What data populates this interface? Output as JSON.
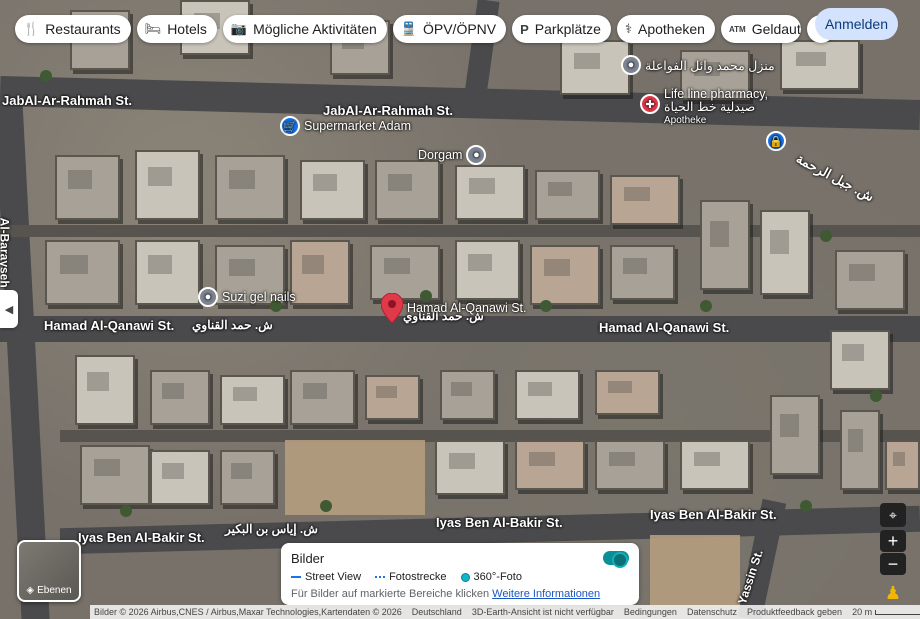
{
  "chips": [
    {
      "icon": "restaurant-icon",
      "glyph": "🍴",
      "label": "Restaurants"
    },
    {
      "icon": "hotel-icon",
      "glyph": "🛏",
      "label": "Hotels"
    },
    {
      "icon": "camera-icon",
      "glyph": "📷",
      "label": "Mögliche Aktivitäten"
    },
    {
      "icon": "transit-icon",
      "glyph": "🚆",
      "label": "ÖPV/ÖPNV"
    },
    {
      "icon": "parking-icon",
      "glyph": "P",
      "label": "Parkplätze"
    },
    {
      "icon": "pharmacy-icon",
      "glyph": "⚕",
      "label": "Apotheken"
    },
    {
      "icon": "atm-icon",
      "glyph": "ATM",
      "label": "Geldauto"
    }
  ],
  "header": {
    "signin_label": "Anmelden"
  },
  "streets": {
    "jabal_top": "JabAl-Ar-Rahmah St.",
    "jabal_mid": "JabAl-Ar-Rahmah St.",
    "jabal_arabic": "ش. جبل الرحمة",
    "hamad_left": "Hamad Al-Qanawi St.",
    "hamad_arabic_left": "ش. حمد القناوي",
    "hamad_center": "Hamad Al-Qanawi St.",
    "hamad_arabic_center": "ش. حمد القناوي",
    "hamad_right": "Hamad Al-Qanawi St.",
    "iyas_left": "Iyas Ben Al-Bakir St.",
    "iyas_arabic": "ش. إياس بن البكير",
    "iyas_center": "Iyas Ben Al-Bakir St.",
    "iyas_right": "Iyas Ben Al-Bakir St.",
    "barayseh": "Al-Barayseh St.",
    "yassin": "Yassin St."
  },
  "places": {
    "supermarket": "Supermarket Adam",
    "dorgam": "Dorgam",
    "suzi": "Suzi gel nails",
    "mohammad_house": "منزل محمد وائل الفواعلة",
    "pharmacy_name": "Life line pharmacy,",
    "pharmacy_arabic": "صيدلية خط الحياة",
    "pharmacy_type": "Apotheke"
  },
  "panel": {
    "title": "Bilder",
    "legend": [
      "Street View",
      "Fotostrecke",
      "360°-Foto"
    ],
    "note": "Für Bilder auf markierte Bereiche klicken",
    "link": "Weitere Informationen"
  },
  "layers_label": "Ebenen",
  "footer": {
    "attribution": "Bilder © 2026 Airbus,CNES / Airbus,Maxar Technologies,Kartendaten © 2026",
    "country": "Deutschland",
    "earth": "3D-Earth-Ansicht ist nicht verfügbar",
    "terms": "Bedingungen",
    "privacy": "Datenschutz",
    "feedback": "Produktfeedback geben",
    "scale": "20 m"
  },
  "colors": {
    "accent": "#1a73e8",
    "signin_bg": "#d3e3fd",
    "marker_red": "#e0394a"
  }
}
